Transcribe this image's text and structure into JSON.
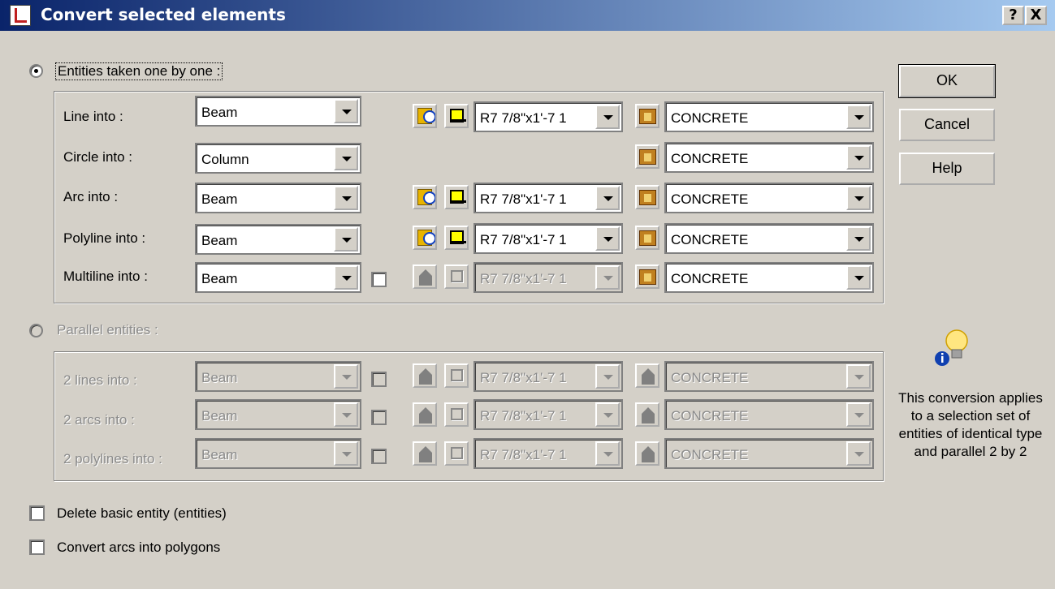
{
  "window": {
    "title": "Convert selected elements",
    "help_btn": "?",
    "close_btn": "X"
  },
  "entities_option": {
    "label": "Entities taken one by one :",
    "rows": [
      {
        "label": "Line into :",
        "type": "Beam",
        "section": "R7 7/8\"x1'-7 1",
        "material": "CONCRETE"
      },
      {
        "label": "Circle into :",
        "type": "Column",
        "material": "CONCRETE"
      },
      {
        "label": "Arc into :",
        "type": "Beam",
        "section": "R7 7/8\"x1'-7 1",
        "material": "CONCRETE"
      },
      {
        "label": "Polyline into :",
        "type": "Beam",
        "section": "R7 7/8\"x1'-7 1",
        "material": "CONCRETE"
      },
      {
        "label": "Multiline into :",
        "type": "Beam",
        "section": "R7 7/8\"x1'-7 1",
        "material": "CONCRETE"
      }
    ]
  },
  "parallel_option": {
    "label": "Parallel entities :",
    "rows": [
      {
        "label": "2 lines into :",
        "type": "Beam",
        "section": "R7 7/8\"x1'-7 1",
        "material": "CONCRETE"
      },
      {
        "label": "2 arcs into :",
        "type": "Beam",
        "section": "R7 7/8\"x1'-7 1",
        "material": "CONCRETE"
      },
      {
        "label": "2 polylines into :",
        "type": "Beam",
        "section": "R7 7/8\"x1'-7 1",
        "material": "CONCRETE"
      }
    ]
  },
  "options": {
    "delete_label": "Delete basic entity (entities)",
    "convert_label": "Convert arcs into polygons"
  },
  "buttons": {
    "ok": "OK",
    "cancel": "Cancel",
    "help": "Help"
  },
  "info": {
    "icon": "info-bulb-icon",
    "text": "This conversion applies to a selection set of entities of identical type and parallel 2 by 2"
  }
}
